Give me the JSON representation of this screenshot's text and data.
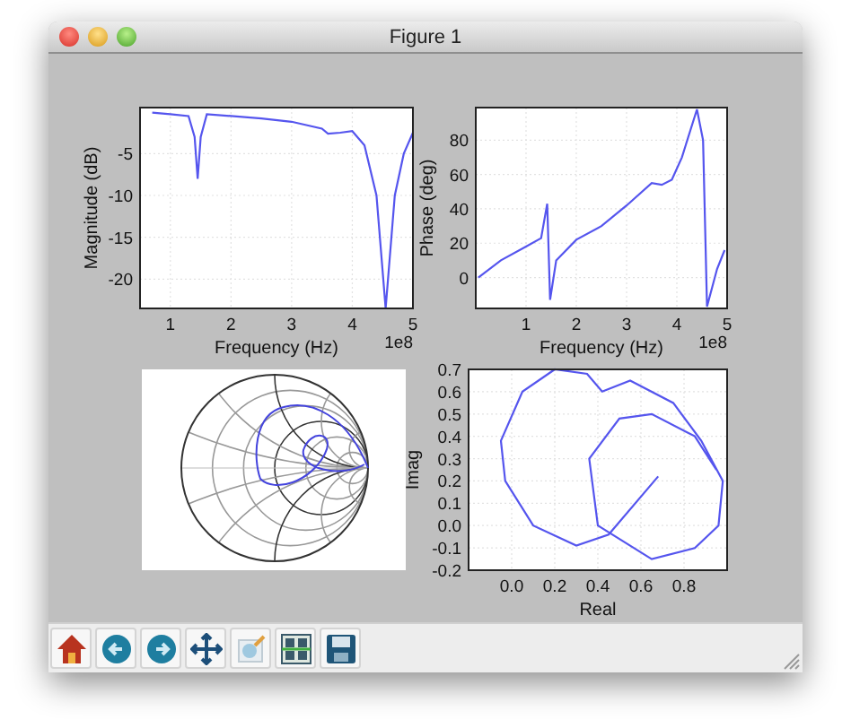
{
  "window": {
    "title": "Figure 1"
  },
  "figure": {
    "axes": [
      {
        "kind": "line",
        "offset_text": "1e8",
        "chart_data": {
          "type": "line",
          "xlabel": "Frequency (Hz)",
          "ylabel": "Magnitude (dB)",
          "xlim": [
            0.5,
            5
          ],
          "ylim": [
            -23.5,
            0.5
          ],
          "xticks": [
            1,
            2,
            3,
            4,
            5
          ],
          "yticks": [
            -5,
            -10,
            -15,
            -20
          ],
          "x": [
            0.7,
            1.0,
            1.3,
            1.4,
            1.45,
            1.5,
            1.6,
            2.0,
            2.5,
            3.0,
            3.5,
            3.6,
            3.8,
            4.0,
            4.2,
            4.4,
            4.55,
            4.7,
            4.85,
            5.0
          ],
          "grid": true,
          "series": [
            {
              "color": "#5555ee",
              "values": [
                -0.1,
                -0.3,
                -0.5,
                -3,
                -8,
                -3,
                -0.3,
                -0.5,
                -0.8,
                -1.2,
                -2,
                -2.6,
                -2.5,
                -2.3,
                -4,
                -10,
                -23.5,
                -10,
                -5,
                -2.5
              ]
            }
          ]
        }
      },
      {
        "kind": "line",
        "offset_text": "1e8",
        "chart_data": {
          "type": "line",
          "xlabel": "Frequency (Hz)",
          "ylabel": "Phase (deg)",
          "xlim": [
            0,
            5
          ],
          "ylim": [
            -18,
            99
          ],
          "xticks": [
            1,
            2,
            3,
            4,
            5
          ],
          "yticks": [
            0,
            20,
            40,
            60,
            80
          ],
          "x": [
            0.05,
            0.5,
            1.0,
            1.3,
            1.42,
            1.48,
            1.6,
            2.0,
            2.5,
            3.0,
            3.5,
            3.7,
            3.9,
            4.1,
            4.4,
            4.52,
            4.6,
            4.8,
            4.95
          ],
          "grid": true,
          "series": [
            {
              "color": "#5555ee",
              "values": [
                0,
                10,
                18,
                23,
                43,
                -13,
                10,
                22,
                30,
                42,
                55,
                54,
                57,
                70,
                98,
                80,
                -17,
                5,
                16
              ]
            }
          ]
        }
      },
      {
        "kind": "smith"
      },
      {
        "kind": "line",
        "chart_data": {
          "type": "line",
          "xlabel": "Real",
          "ylabel": "Imag",
          "xlim": [
            -0.2,
            1.0
          ],
          "ylim": [
            -0.2,
            0.7
          ],
          "xticks": [
            {
              "value": 0,
              "label": "0.0"
            },
            {
              "value": 0.2,
              "label": "0.2"
            },
            {
              "value": 0.4,
              "label": "0.4"
            },
            {
              "value": 0.6,
              "label": "0.6"
            },
            {
              "value": 0.8,
              "label": "0.8"
            }
          ],
          "yticks": [
            {
              "value": -0.2,
              "label": "-0.2"
            },
            {
              "value": -0.1,
              "label": "-0.1"
            },
            {
              "value": 0,
              "label": "0.0"
            },
            {
              "value": 0.1,
              "label": "0.1"
            },
            {
              "value": 0.2,
              "label": "0.2"
            },
            {
              "value": 0.3,
              "label": "0.3"
            },
            {
              "value": 0.4,
              "label": "0.4"
            },
            {
              "value": 0.5,
              "label": "0.5"
            },
            {
              "value": 0.6,
              "label": "0.6"
            },
            {
              "value": 0.7,
              "label": "0.7"
            }
          ],
          "x": [
            0.68,
            0.45,
            0.3,
            0.1,
            -0.03,
            -0.05,
            0.05,
            0.2,
            0.35,
            0.42,
            0.55,
            0.75,
            0.88,
            0.98,
            0.96,
            0.85,
            0.65,
            0.4,
            0.36,
            0.5,
            0.65,
            0.85,
            0.95
          ],
          "grid": true,
          "series": [
            {
              "color": "#5555ee",
              "values": [
                0.22,
                -0.04,
                -0.09,
                0.0,
                0.2,
                0.38,
                0.6,
                0.7,
                0.68,
                0.6,
                0.65,
                0.55,
                0.38,
                0.2,
                0.0,
                -0.1,
                -0.15,
                0.0,
                0.3,
                0.48,
                0.5,
                0.4,
                0.25
              ]
            }
          ]
        }
      }
    ]
  },
  "toolbar": [
    {
      "kind": "home"
    },
    {
      "kind": "back"
    },
    {
      "kind": "forward"
    },
    {
      "kind": "pan"
    },
    {
      "kind": "zoom"
    },
    {
      "kind": "configure"
    },
    {
      "kind": "save"
    }
  ]
}
